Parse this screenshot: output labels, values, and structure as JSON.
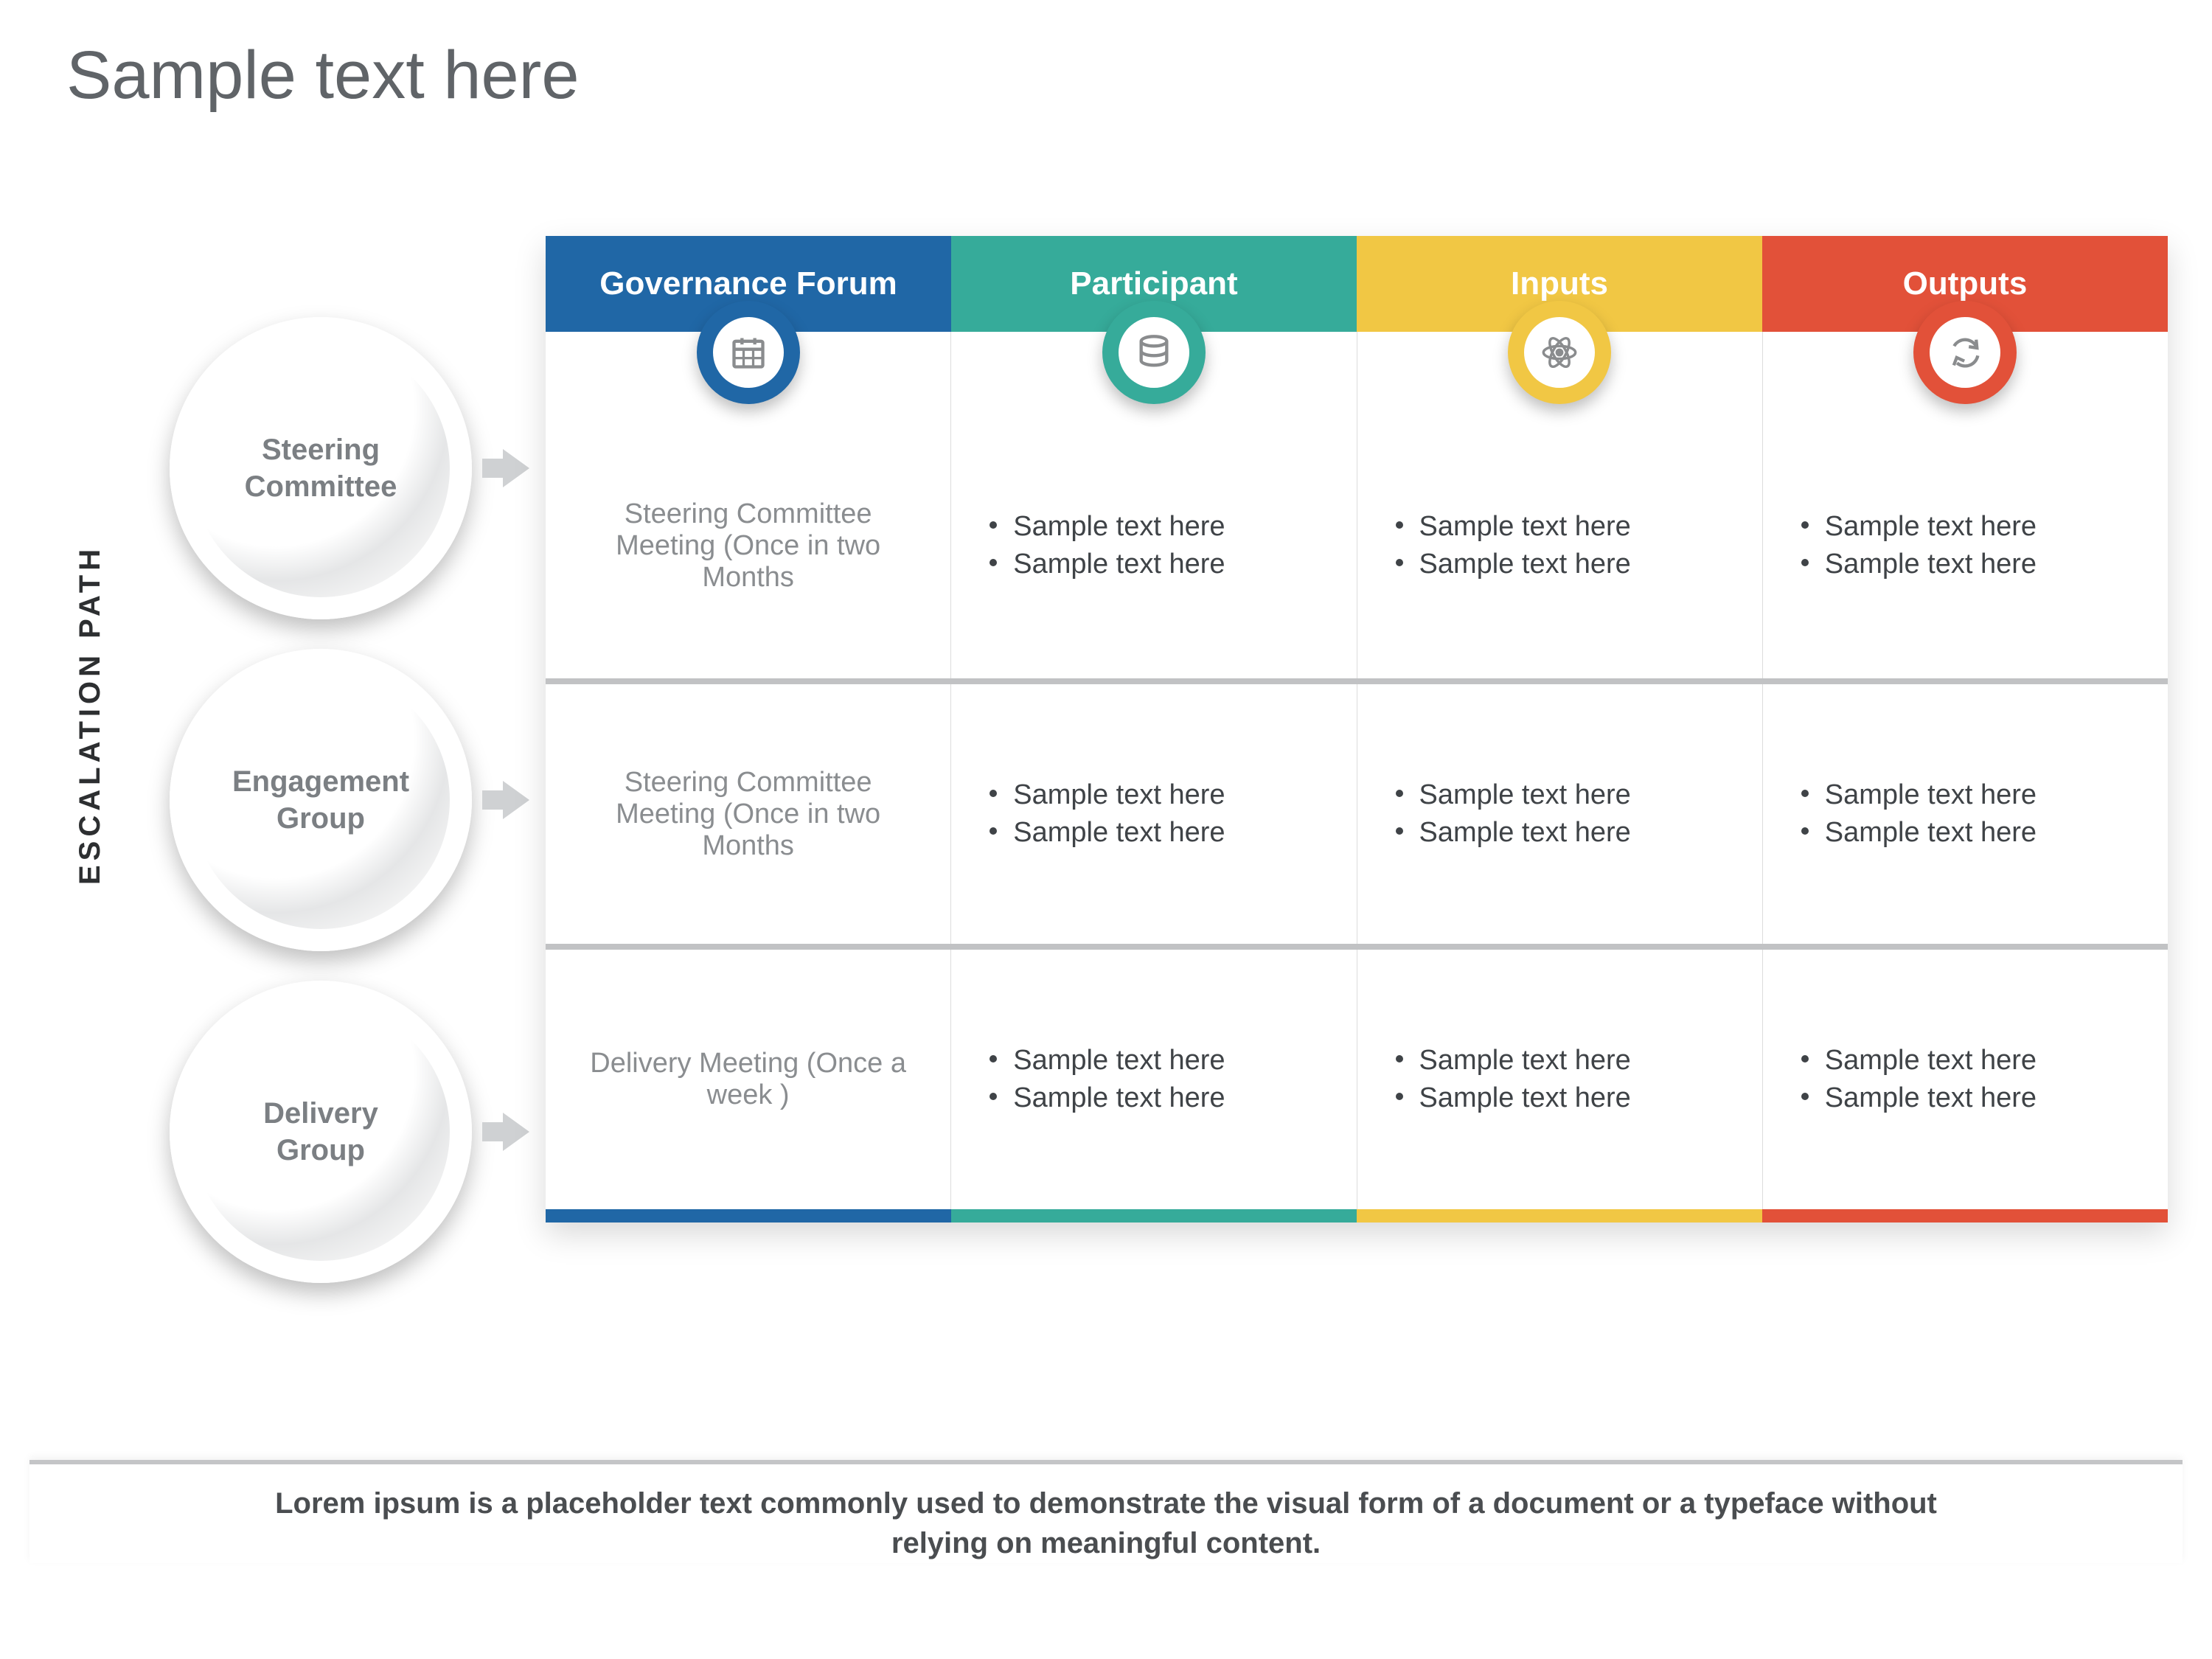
{
  "title": "Sample text here",
  "vlabel": "ESCALATION  PATH",
  "columns": [
    {
      "label": "Governance Forum",
      "color": "blue",
      "icon": "calendar"
    },
    {
      "label": "Participant",
      "color": "teal",
      "icon": "database"
    },
    {
      "label": "Inputs",
      "color": "yellow",
      "icon": "atom"
    },
    {
      "label": "Outputs",
      "color": "orange",
      "icon": "cycle"
    }
  ],
  "rows": [
    {
      "circle": "Steering Committee",
      "gov": "Steering Committee Meeting (Once in two Months",
      "participant": [
        "Sample text here",
        "Sample text here"
      ],
      "inputs": [
        "Sample text here",
        "Sample text here"
      ],
      "outputs": [
        "Sample text here",
        "Sample text here"
      ]
    },
    {
      "circle": "Engagement Group",
      "gov": "Steering Committee Meeting (Once in two Months",
      "participant": [
        "Sample text here",
        "Sample text here"
      ],
      "inputs": [
        "Sample text here",
        "Sample text here"
      ],
      "outputs": [
        "Sample text here",
        "Sample text here"
      ]
    },
    {
      "circle": "Delivery Group",
      "gov": "Delivery Meeting (Once a week )",
      "participant": [
        "Sample text here",
        "Sample text here"
      ],
      "inputs": [
        "Sample text here",
        "Sample text here"
      ],
      "outputs": [
        "Sample text here",
        "Sample text here"
      ]
    }
  ],
  "caption": "Lorem ipsum is a placeholder text commonly used to demonstrate the visual form of a document or a typeface without relying on meaningful content."
}
